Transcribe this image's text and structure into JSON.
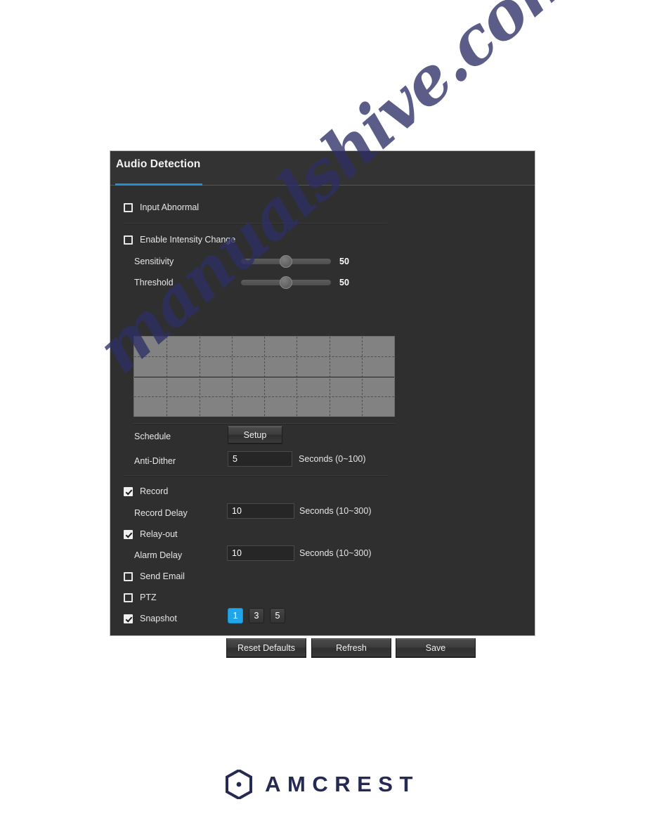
{
  "panel": {
    "title": "Audio Detection",
    "accent_color": "#1f8fd6",
    "background_color": "#2f2f2f"
  },
  "watermark": {
    "text": "manualshive.com",
    "color": "#2e2f66"
  },
  "settings": {
    "input_abnormal": {
      "label": "Input Abnormal",
      "checked": false
    },
    "enable_intensity_change": {
      "label": "Enable Intensity Change",
      "checked": false
    },
    "sensitivity": {
      "label": "Sensitivity",
      "value": "50",
      "percent": 50
    },
    "threshold": {
      "label": "Threshold",
      "value": "50",
      "percent": 50
    },
    "schedule": {
      "label": "Schedule",
      "button_label": "Setup"
    },
    "anti_dither": {
      "label": "Anti-Dither",
      "value": "5",
      "unit": "Seconds (0~100)"
    },
    "record": {
      "label": "Record",
      "checked": true
    },
    "record_delay": {
      "label": "Record Delay",
      "value": "10",
      "unit": "Seconds (10~300)"
    },
    "relay_out": {
      "label": "Relay-out",
      "checked": true
    },
    "alarm_delay": {
      "label": "Alarm Delay",
      "value": "10",
      "unit": "Seconds (10~300)"
    },
    "send_email": {
      "label": "Send Email",
      "checked": false
    },
    "ptz": {
      "label": "PTZ",
      "checked": false
    },
    "snapshot": {
      "label": "Snapshot",
      "checked": true,
      "options": [
        "1",
        "3",
        "5"
      ],
      "selected": "1",
      "selected_color": "#1fa5e8"
    }
  },
  "actions": {
    "reset_defaults": "Reset Defaults",
    "refresh": "Refresh",
    "save": "Save"
  },
  "footer": {
    "brand": "AMCREST",
    "brand_color": "#252a52"
  }
}
